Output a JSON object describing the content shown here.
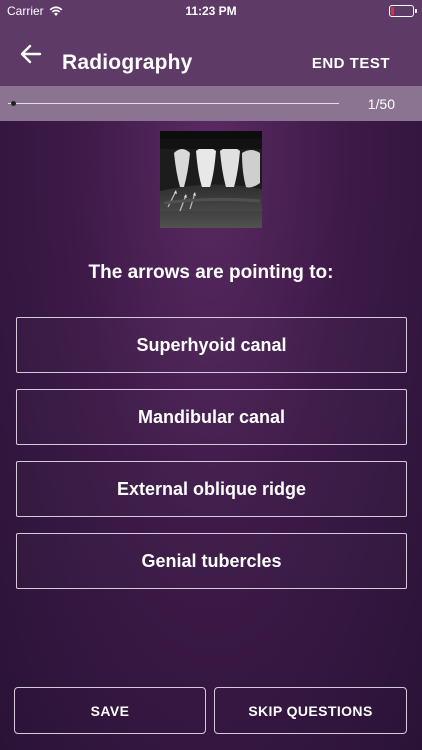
{
  "status_bar": {
    "carrier": "Carrier",
    "time": "11:23 PM"
  },
  "nav": {
    "title": "Radiography",
    "end_test": "END TEST"
  },
  "progress": {
    "counter": "1/50",
    "fraction": 0.02
  },
  "question": {
    "text": "The arrows are pointing to:"
  },
  "options": [
    {
      "label": "Superhyoid canal"
    },
    {
      "label": "Mandibular canal"
    },
    {
      "label": "External oblique ridge"
    },
    {
      "label": "Genial tubercles"
    }
  ],
  "actions": {
    "save": "SAVE",
    "skip": "SKIP QUESTIONS"
  },
  "colors": {
    "nav_bg": "#5e3a66",
    "progress_bg": "#8a7491",
    "battery_low": "#e53030"
  }
}
